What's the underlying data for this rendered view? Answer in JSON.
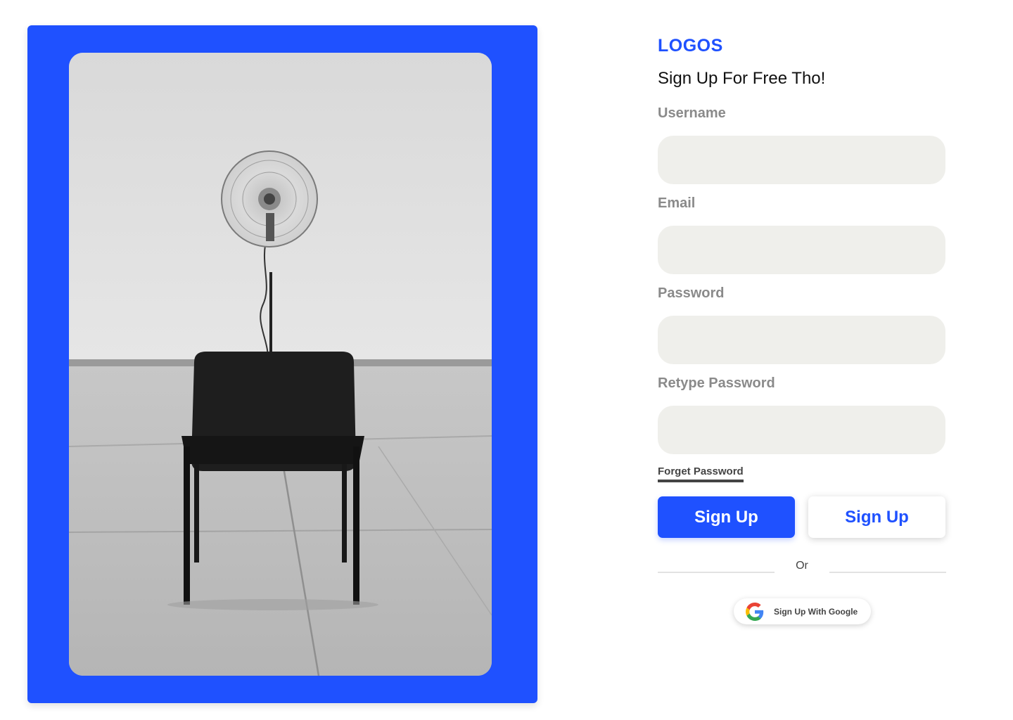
{
  "brand": {
    "logo": "LOGOS",
    "color": "#1f51ff"
  },
  "form": {
    "heading": "Sign Up For Free Tho!",
    "fields": [
      {
        "label": "Username",
        "value": "",
        "placeholder": ""
      },
      {
        "label": "Email",
        "value": "",
        "placeholder": ""
      },
      {
        "label": "Password",
        "value": "",
        "placeholder": ""
      },
      {
        "label": "Retype Password",
        "value": "",
        "placeholder": ""
      }
    ],
    "forgot_label": "Forget Password",
    "primary_button": "Sign Up",
    "secondary_button": "Sign Up",
    "divider_text": "Or",
    "google_button": "Sign Up With Google"
  },
  "hero": {
    "photo_subject": "chair-and-fan-photo",
    "panel_color": "#1f51ff"
  },
  "icons": {
    "google": "google-icon"
  }
}
